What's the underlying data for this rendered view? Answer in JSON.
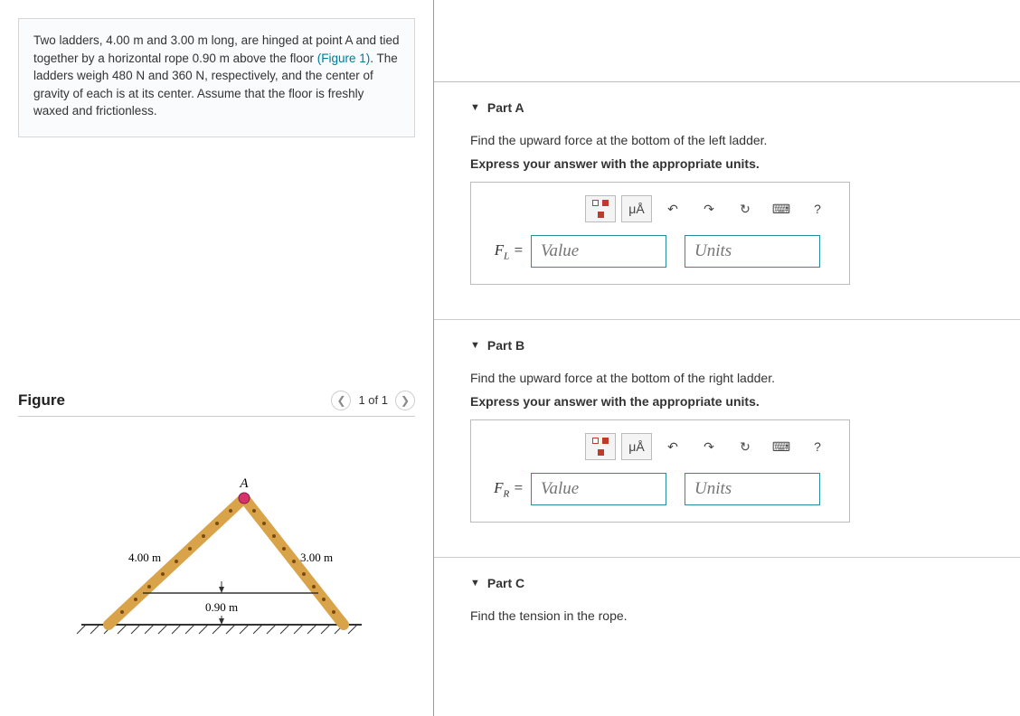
{
  "problem": {
    "text_before_figref": "Two ladders, 4.00 m and 3.00 m long, are hinged at point A and tied together by a horizontal rope 0.90 m above the floor ",
    "figref": "(Figure 1)",
    "text_after_figref": ". The ladders weigh 480 N and 360 N, respectively, and the center of gravity of each is at its center. Assume that the floor is freshly waxed and frictionless."
  },
  "figure": {
    "title": "Figure",
    "counter": "1 of 1",
    "labels": {
      "apex": "A",
      "left_len": "4.00 m",
      "right_len": "3.00 m",
      "rope_h": "0.90 m"
    }
  },
  "parts": {
    "a": {
      "title": "Part A",
      "prompt": "Find the upward force at the bottom of the left ladder.",
      "instruction": "Express your answer with the appropriate units.",
      "var_main": "F",
      "var_sub": "L",
      "eq": " = ",
      "value_ph": "Value",
      "units_ph": "Units"
    },
    "b": {
      "title": "Part B",
      "prompt": "Find the upward force at the bottom of the right ladder.",
      "instruction": "Express your answer with the appropriate units.",
      "var_main": "F",
      "var_sub": "R",
      "eq": " = ",
      "value_ph": "Value",
      "units_ph": "Units"
    },
    "c": {
      "title": "Part C",
      "prompt": "Find the tension in the rope."
    }
  },
  "toolbar": {
    "templates": "templates-icon",
    "units_symbol": "μÅ",
    "undo": "↶",
    "redo": "↷",
    "reset": "↻",
    "keyboard": "⌨",
    "help": "?"
  },
  "chart_data": {
    "type": "diagram",
    "description": "Two ladders hinged at apex A forming an inverted V on a floor, tied by a horizontal rope 0.90 m above the floor.",
    "left_ladder_length_m": 4.0,
    "right_ladder_length_m": 3.0,
    "rope_height_m": 0.9,
    "left_ladder_weight_N": 480,
    "right_ladder_weight_N": 360,
    "floor_friction": "frictionless"
  }
}
